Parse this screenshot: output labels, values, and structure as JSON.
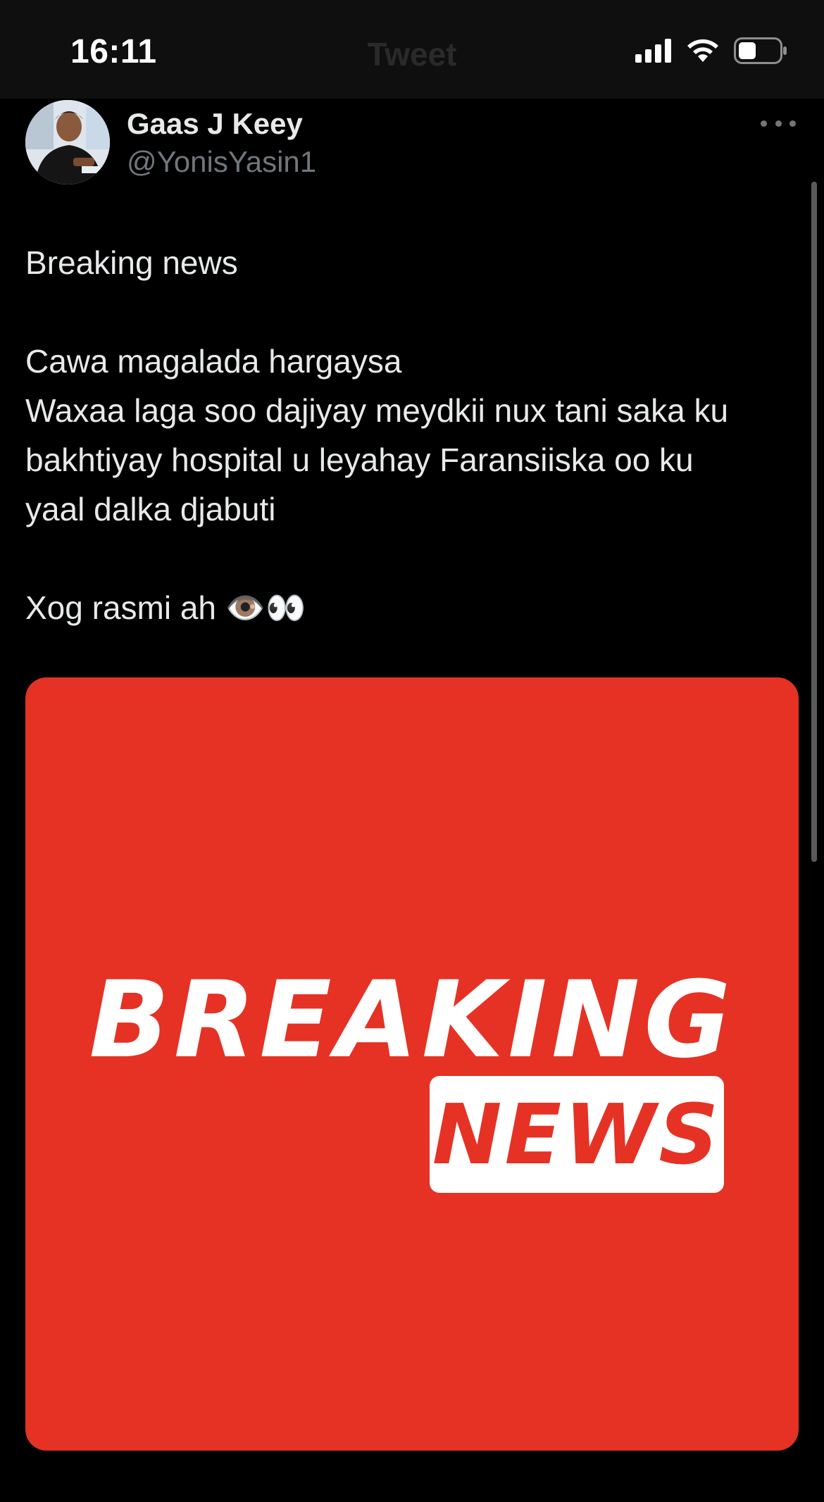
{
  "status_bar": {
    "time": "16:11",
    "icons": [
      "cellular-signal-icon",
      "wifi-icon",
      "battery-icon"
    ]
  },
  "header": {
    "title": "Tweet"
  },
  "tweet": {
    "author_name": "Gaas J Keey",
    "author_handle": "@YonisYasin1",
    "text_lines": {
      "l1": "Breaking news",
      "l2": "Cawa magalada hargaysa",
      "l3": "Waxaa laga soo dajiyay meydkii nux tani saka ku",
      "l4": "bakhtiyay hospital u leyahay Faransiiska oo ku",
      "l5": "yaal dalka  djabuti",
      "l6": "Xog rasmi ah 👁️👀"
    },
    "media": {
      "headline_top": "BREAKING",
      "headline_bottom": "NEWS",
      "background_color": "#e53224"
    }
  },
  "colors": {
    "background": "#000000",
    "primary_text": "#e7e9ea",
    "secondary_text": "#71767b"
  }
}
